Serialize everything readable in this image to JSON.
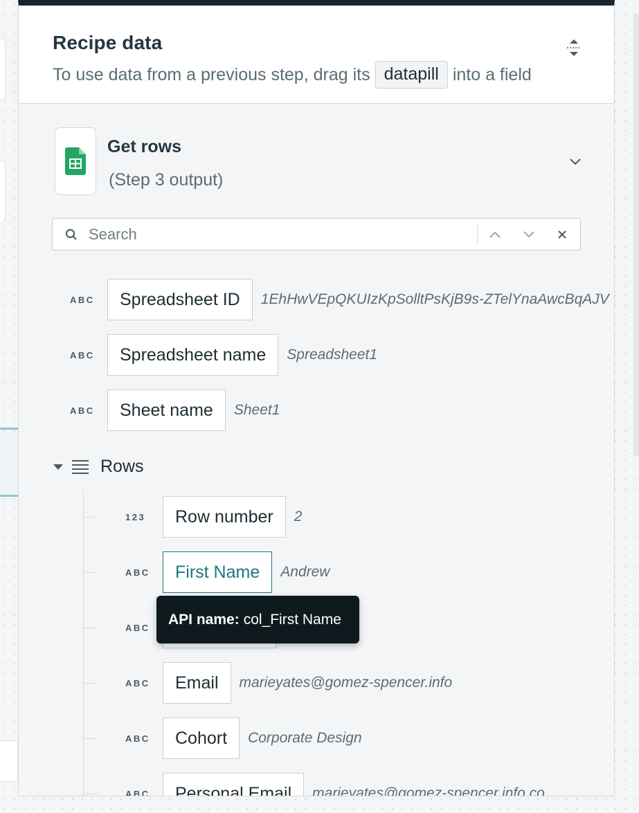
{
  "panel": {
    "title": "Recipe data",
    "subtitle_before": "To use data from a previous step, drag its",
    "subtitle_chip": "datapill",
    "subtitle_after": "into a field"
  },
  "step": {
    "title": "Get rows",
    "subtitle": "(Step 3 output)",
    "app_icon": "google-sheets-icon"
  },
  "search": {
    "placeholder": "Search",
    "value": ""
  },
  "fields": [
    {
      "type": "ABC",
      "label": "Spreadsheet ID",
      "sample": "1EhHwVEpQKUIzKpSolltPsKjB9s-ZTelYnaAwcBqAJV"
    },
    {
      "type": "ABC",
      "label": "Spreadsheet name",
      "sample": "Spreadsheet1"
    },
    {
      "type": "ABC",
      "label": "Sheet name",
      "sample": "Sheet1"
    }
  ],
  "rows_group": {
    "label": "Rows",
    "expanded": true,
    "fields": [
      {
        "type": "123",
        "label": "Row number",
        "sample": "2"
      },
      {
        "type": "ABC",
        "label": "First Name",
        "sample": "Andrew",
        "active": true
      },
      {
        "type": "ABC",
        "label": "",
        "sample": ""
      },
      {
        "type": "ABC",
        "label": "Email",
        "sample": "marieyates@gomez-spencer.info"
      },
      {
        "type": "ABC",
        "label": "Cohort",
        "sample": "Corporate Design"
      },
      {
        "type": "ABC",
        "label": "Personal Email",
        "sample": "marieyates@gomez-spencer.info.co"
      }
    ]
  },
  "tooltip": {
    "key": "API name:",
    "value": "col_First Name"
  },
  "colors": {
    "accent": "#1a7682",
    "header_bar": "#17262d",
    "sheets_green": "#23a566"
  }
}
